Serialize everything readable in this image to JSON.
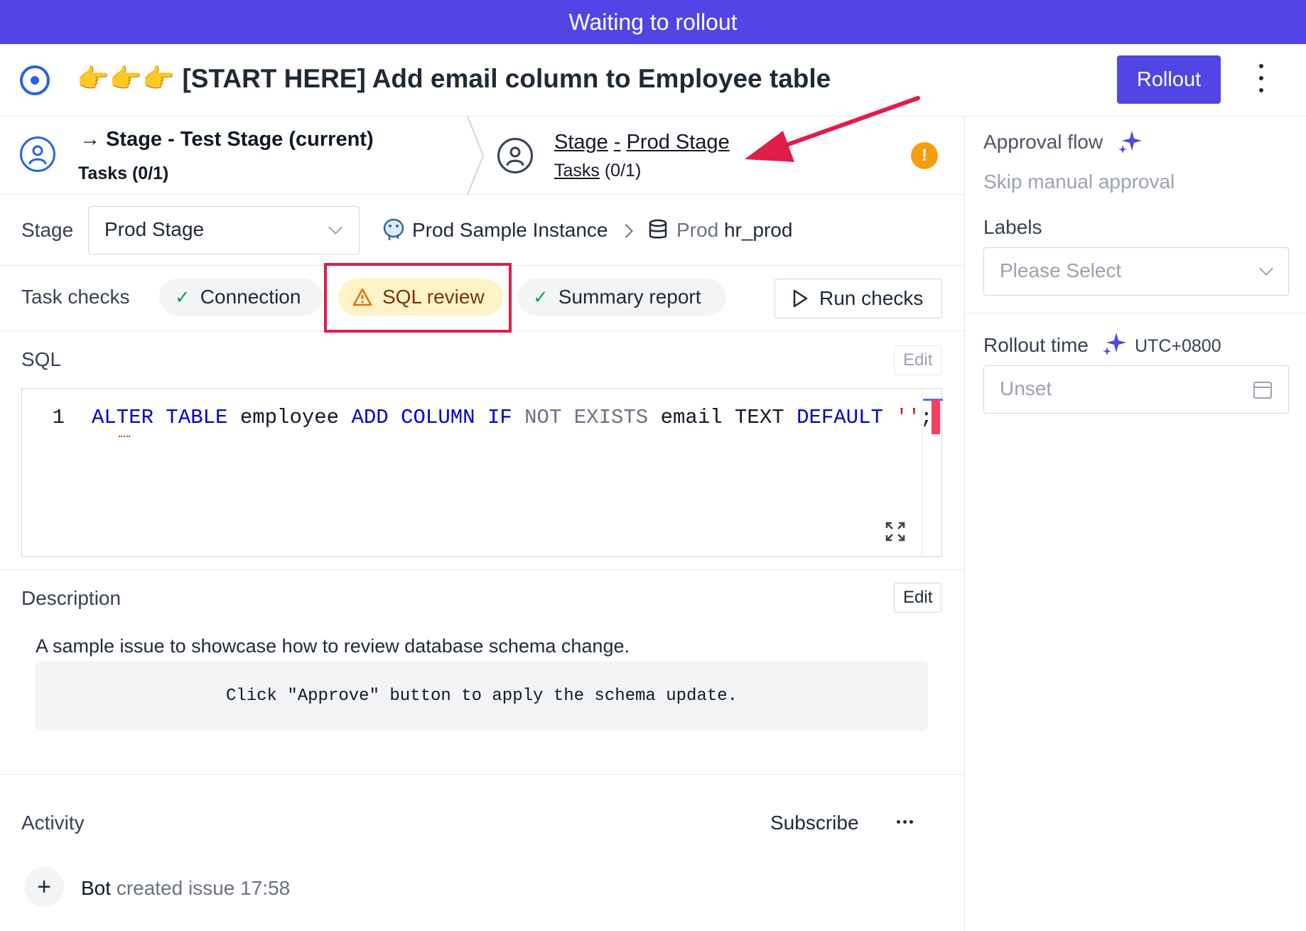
{
  "banner": {
    "text": "Waiting to rollout"
  },
  "header": {
    "title": "👉👉👉 [START HERE] Add email column to Employee table",
    "rollout_label": "Rollout"
  },
  "stages": {
    "current": {
      "arrow": "→",
      "title": "Stage - Test Stage (current)",
      "tasks": "Tasks (0/1)"
    },
    "next": {
      "stage_word": "Stage",
      "dash": "-",
      "name": "Prod Stage",
      "tasks_word": "Tasks",
      "tasks_count": "(0/1)"
    },
    "warning_glyph": "!"
  },
  "stage_row": {
    "label": "Stage",
    "selected": "Prod Stage",
    "instance": "Prod Sample Instance",
    "env": "Prod",
    "database": "hr_prod"
  },
  "checks": {
    "label": "Task checks",
    "items": [
      {
        "label": "Connection",
        "status": "success"
      },
      {
        "label": "SQL review",
        "status": "warning"
      },
      {
        "label": "Summary report",
        "status": "success"
      }
    ],
    "run_label": "Run checks"
  },
  "sql": {
    "title": "SQL",
    "edit_label": "Edit",
    "line_number": "1",
    "tokens": {
      "t1": "ALTER",
      "t2": "TABLE",
      "t3": "employee",
      "t4": "ADD",
      "t5": "COLUMN",
      "t6": "IF",
      "t7": "NOT",
      "t8": "EXISTS",
      "t9": "email",
      "t10": "TEXT",
      "t11": "DEFAULT",
      "t12": "''",
      "t13": ";"
    }
  },
  "description": {
    "title": "Description",
    "edit_label": "Edit",
    "text": "A sample issue to showcase how to review database schema change.",
    "code": "Click \"Approve\" button to apply the schema update."
  },
  "activity": {
    "title": "Activity",
    "subscribe_label": "Subscribe",
    "entry": {
      "actor": "Bot",
      "action": "created issue",
      "time": "17:58"
    }
  },
  "sidebar": {
    "approval_title": "Approval flow",
    "approval_value": "Skip manual approval",
    "labels_title": "Labels",
    "labels_placeholder": "Please Select",
    "rollout_title": "Rollout time",
    "timezone": "UTC+0800",
    "rollout_placeholder": "Unset"
  },
  "colors": {
    "accent": "#4f46e5",
    "warning": "#f59e0b",
    "success": "#16a34a",
    "highlight": "#e11d48"
  }
}
